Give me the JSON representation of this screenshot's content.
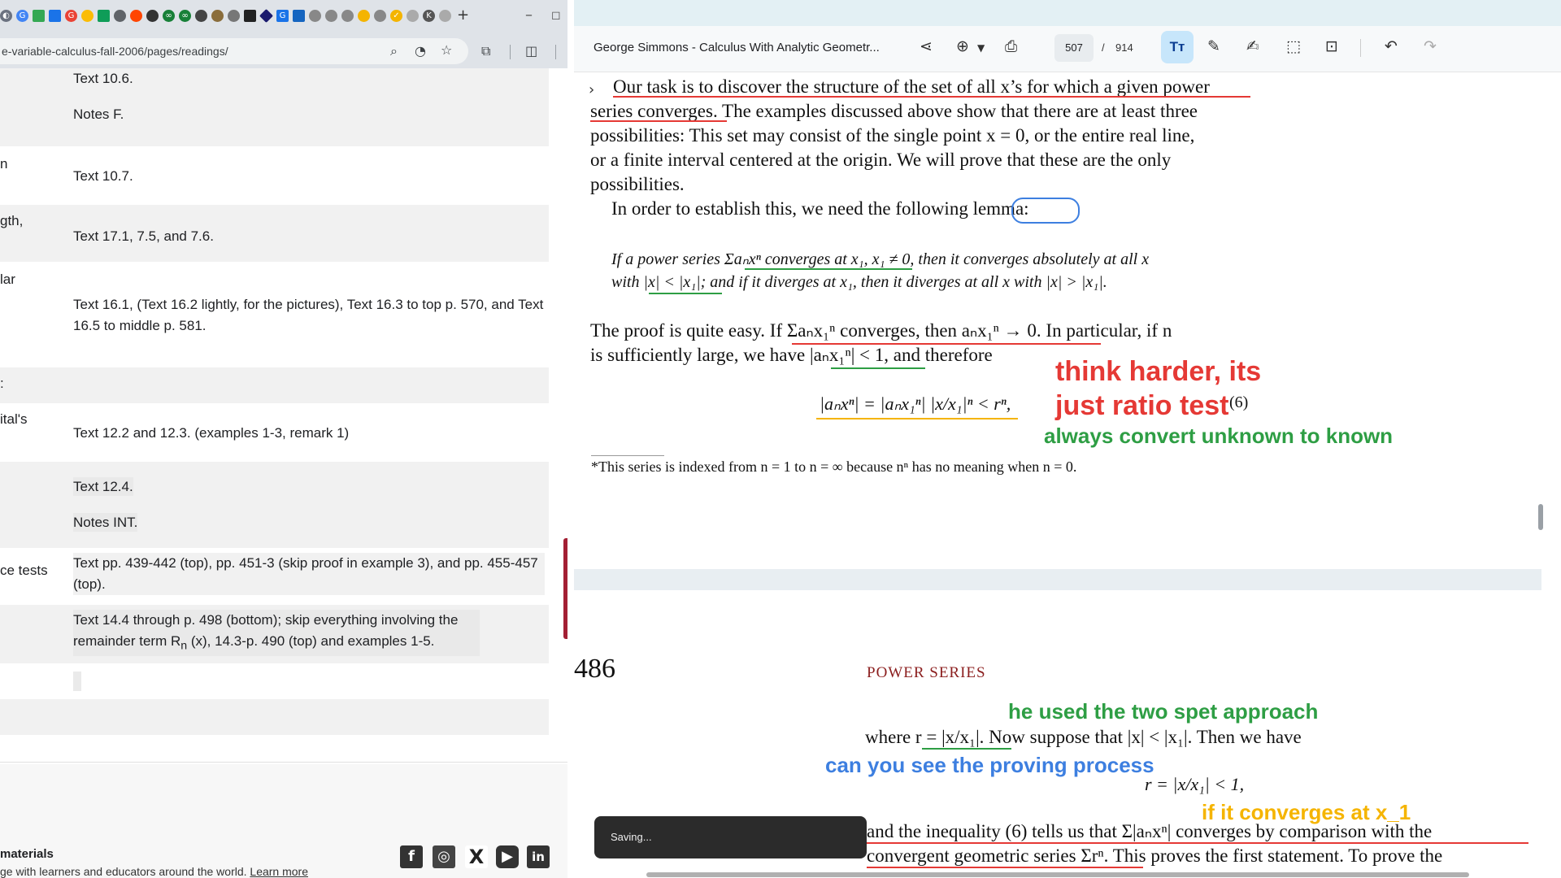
{
  "browser": {
    "url": "e-variable-calculus-fall-2006/pages/readings/",
    "new_tab": "+",
    "minimize": "–",
    "maximize": "◻"
  },
  "readings": {
    "rows": [
      {
        "label": "",
        "lines": [
          "Text 10.6.",
          "Notes F."
        ]
      },
      {
        "label": "n",
        "lines": [
          "Text 10.7."
        ]
      },
      {
        "label": "gth,",
        "lines": [
          "Text 17.1, 7.5, and 7.6."
        ]
      },
      {
        "label": "lar",
        "lines": [
          "Text 16.1, (Text 16.2 lightly, for the pictures), Text 16.3 to top p. 570, and Text 16.5 to middle p. 581."
        ]
      },
      {
        "label": ":",
        "lines": [
          ""
        ]
      },
      {
        "label": "ital's",
        "lines": [
          "Text 12.2 and 12.3. (examples 1-3, remark 1)"
        ]
      },
      {
        "label": "",
        "lines": [
          "Text 12.4.",
          "Notes INT."
        ]
      },
      {
        "label": "ce tests",
        "lines": [
          "Text pp. 439-442 (top), pp. 451-3 (skip proof in example 3), and pp. 455-457 (top)."
        ]
      },
      {
        "label": "",
        "lines": [
          "Text 14.4 through p. 498 (bottom); skip everything involving the",
          "remainder term R",
          "n",
          " (x), 14.3-p. 490 (top) and examples 1-5."
        ]
      }
    ]
  },
  "footer": {
    "heading": "materials",
    "text": "ge with learners and educators around the world.",
    "link": "Learn more"
  },
  "pdf": {
    "title": "George Simmons - Calculus With Analytic Geometr...",
    "page_current": "507",
    "page_sep": "/",
    "page_total": "914",
    "saving": "Saving...",
    "page_number": "486",
    "running_head": "POWER SERIES",
    "lines": {
      "l1": "Our task is to discover the structure of the set of all x’s for which a given power",
      "l2": "series converges. The examples discussed above show that there are at least three",
      "l3": "possibilities: This set may consist of the single point x = 0, or the entire real line,",
      "l4": "or a finite interval centered at the origin. We will prove that these are the only",
      "l5": "possibilities.",
      "l6": "In order to establish this, we need the following lemma:",
      "l7": "If a power series Σaₙxⁿ converges at x₁, x₁ ≠ 0, then it converges absolutely at all x",
      "l8": "with |x| < |x₁|; and if it diverges at x₁, then it diverges at all x with |x| > |x₁|.",
      "l9": "The proof is quite easy. If Σaₙx₁ⁿ converges, then aₙx₁ⁿ → 0. In particular, if n",
      "l10": "is sufficiently large, we have |aₙx₁ⁿ| < 1, and therefore",
      "eq": "|aₙxⁿ| = |aₙx₁ⁿ| |x/x₁|ⁿ < rⁿ,",
      "eqnum": "(6)",
      "footnote": "*This series is indexed from n = 1 to n = ∞ because nⁿ has no meaning when n = 0.",
      "p2l1": "where r = |x/x₁|. Now suppose that |x| < |x₁|. Then we have",
      "p2eq": "r = |x/x₁| < 1,",
      "p2l2": "and the inequality (6) tells us that Σ|aₙxⁿ| converges by comparison with the",
      "p2l3": "convergent geometric series Σrⁿ. This proves the first statement. To prove the"
    },
    "annotations": {
      "a1": "think harder, its",
      "a2": "just ratio test",
      "a3": "always convert unknown to known",
      "a4": "he used the two spet approach",
      "a5": "can you see the proving process",
      "a6": "if it converges at x_1"
    }
  },
  "colors": {
    "red_note": "#e53935",
    "green_note": "#2e9e44",
    "blue_note": "#3d7fe0",
    "yellow_note": "#f5b400",
    "accent": "#c7e6fb"
  },
  "icons": [
    "share-icon",
    "zoom-icon",
    "print-icon",
    "text-icon",
    "draw-icon",
    "highlight-icon",
    "select-icon",
    "screenshot-icon",
    "undo-icon",
    "redo-icon"
  ]
}
